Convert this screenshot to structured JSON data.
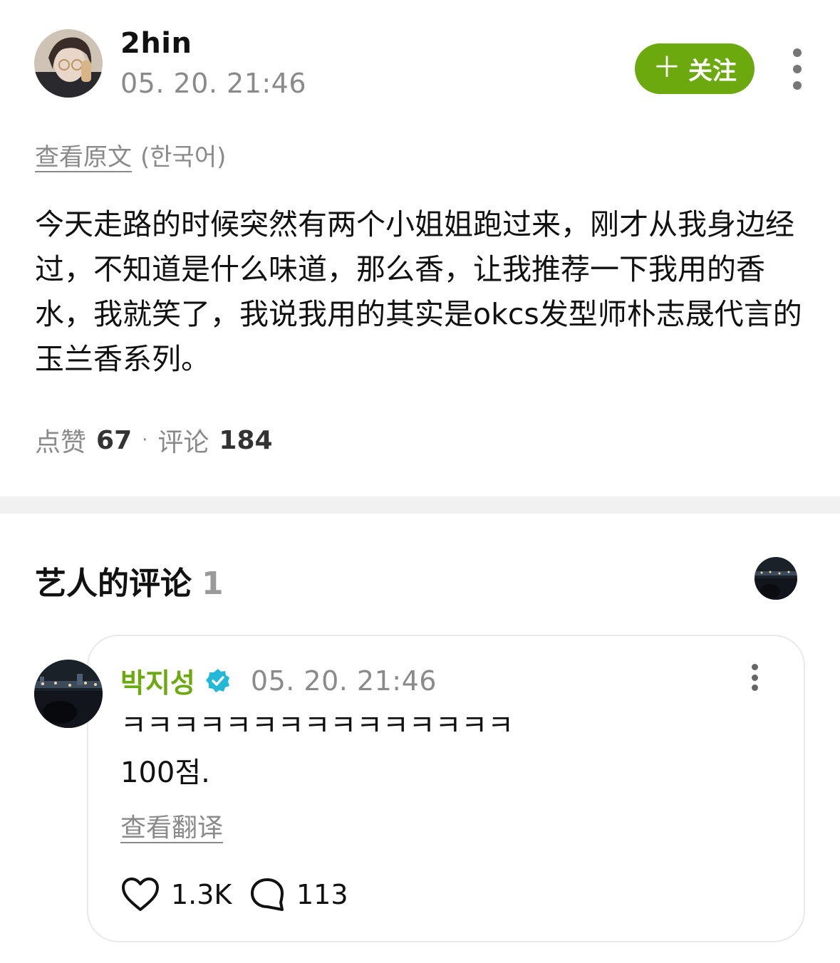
{
  "post": {
    "author": "2hin",
    "time": "05. 20. 21:46",
    "follow_label": "关注",
    "follow_plus": "＋",
    "view_original": "查看原文",
    "original_lang": "(한국어)",
    "body": "今天走路的时候突然有两个小姐姐跑过来，刚才从我身边经过，不知道是什么味道，那么香，让我推荐一下我用的香水，我就笑了，我说我用的其实是okcs发型师朴志晟代言的玉兰香系列。",
    "likes_label": "点赞",
    "likes_count": "67",
    "separator": "·",
    "comments_label": "评论",
    "comments_count": "184"
  },
  "artist_comments": {
    "title": "艺人的评论",
    "count": "1"
  },
  "comment": {
    "author": "박지성",
    "time": "05. 20. 21:46",
    "line1": "ㅋㅋㅋㅋㅋㅋㅋㅋㅋㅋㅋㅋㅋㅋㅋ",
    "line2": "100점.",
    "translate": "查看翻译",
    "likes": "1.3K",
    "replies": "113"
  },
  "colors": {
    "accent_green": "#6ca90f",
    "verify_blue": "#22b8d8",
    "muted_text": "#8a8a8a"
  },
  "icons": {
    "follow": "plus-icon",
    "more": "kebab-menu-icon",
    "verified": "verified-badge-icon",
    "like": "heart-icon",
    "reply": "speech-bubble-icon"
  }
}
